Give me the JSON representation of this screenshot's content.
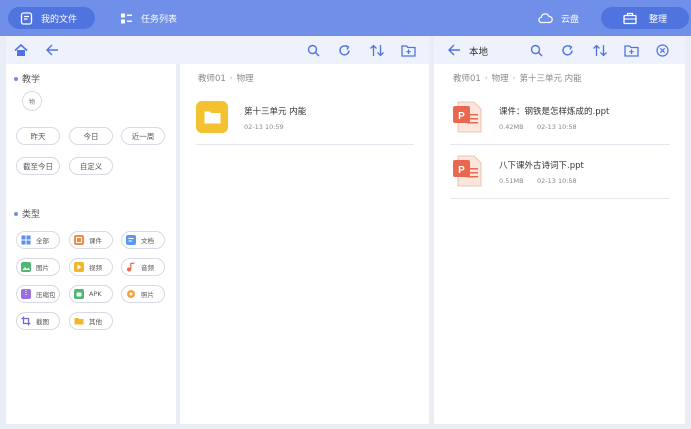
{
  "topbar": {
    "my_files": "我的文件",
    "task_list": "任务列表",
    "cloud": "云盘",
    "organize": "整理"
  },
  "filters": {
    "subject_section": "教学",
    "subject_tag": "物",
    "time_tags": [
      "昨天",
      "今日",
      "近一周",
      "截至今日",
      "自定义"
    ],
    "type_section": "类型",
    "types": [
      {
        "label": "全部",
        "color": "#5b8def"
      },
      {
        "label": "课件",
        "color": "#f08a4b"
      },
      {
        "label": "文档",
        "color": "#5b9bef"
      },
      {
        "label": "图片",
        "color": "#4cb872"
      },
      {
        "label": "视频",
        "color": "#f2b62b"
      },
      {
        "label": "音频",
        "color": "#e8694f"
      },
      {
        "label": "压缩包",
        "color": "#9b6fe0"
      },
      {
        "label": "APK",
        "color": "#4cb872"
      },
      {
        "label": "照片",
        "color": "#f2a33a"
      },
      {
        "label": "截图",
        "color": "#7a63d8"
      },
      {
        "label": "其他",
        "color": "#f2b62b"
      }
    ]
  },
  "middle": {
    "breadcrumb": [
      "教师01",
      "物理"
    ],
    "items": [
      {
        "name": "第十三单元 内能",
        "meta": "02-13 10:59"
      }
    ]
  },
  "right": {
    "title": "本地",
    "breadcrumb": [
      "教师01",
      "物理",
      "第十三单元 内能"
    ],
    "items": [
      {
        "name": "课件：钢铁是怎样炼成的.ppt",
        "size": "0.42MB",
        "date": "02-13 10:58"
      },
      {
        "name": "八下课外古诗词下.ppt",
        "size": "0.51MB",
        "date": "02-13 10:58"
      }
    ]
  }
}
